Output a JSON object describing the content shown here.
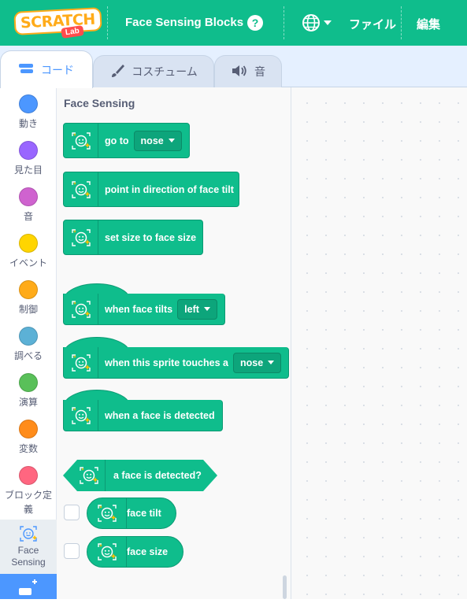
{
  "menubar": {
    "logo_text": "SCRATCH",
    "logo_badge": "Lab",
    "project_title": "Face Sensing Blocks",
    "help_symbol": "?",
    "language_icon": "globe-icon",
    "file_label": "ファイル",
    "edit_label": "編集"
  },
  "tabs": [
    {
      "label": "コード",
      "icon": "code-icon"
    },
    {
      "label": "コスチューム",
      "icon": "brush-icon"
    },
    {
      "label": "音",
      "icon": "speaker-icon"
    }
  ],
  "categories": [
    {
      "label": "動き",
      "color": "#4c97ff"
    },
    {
      "label": "見た目",
      "color": "#9966ff"
    },
    {
      "label": "音",
      "color": "#cf63cf"
    },
    {
      "label": "イベント",
      "color": "#ffd500"
    },
    {
      "label": "制御",
      "color": "#ffab19"
    },
    {
      "label": "調べる",
      "color": "#5cb1d6"
    },
    {
      "label": "演算",
      "color": "#59c059"
    },
    {
      "label": "変数",
      "color": "#ff8c1a"
    },
    {
      "label": "ブロック定義",
      "color": "#ff6680"
    },
    {
      "label": "Face Sensing",
      "color": "#0fbd8c"
    }
  ],
  "palette": {
    "title": "Face Sensing",
    "blocks": {
      "go_to": {
        "text": "go to",
        "dropdown": "nose"
      },
      "point_direction": {
        "text": "point in direction of face tilt"
      },
      "set_size": {
        "text": "set size to face size"
      },
      "when_tilts": {
        "text": "when face tilts",
        "dropdown": "left"
      },
      "when_touches": {
        "text": "when this sprite touches a",
        "dropdown": "nose"
      },
      "when_detected": {
        "text": "when a face is detected"
      },
      "is_detected": {
        "text": "a face is detected?"
      },
      "face_tilt": {
        "text": "face tilt"
      },
      "face_size": {
        "text": "face size"
      }
    }
  },
  "colors": {
    "menubar": "#0fbd8c",
    "block": "#0fbd8c",
    "accent": "#4c97ff"
  }
}
